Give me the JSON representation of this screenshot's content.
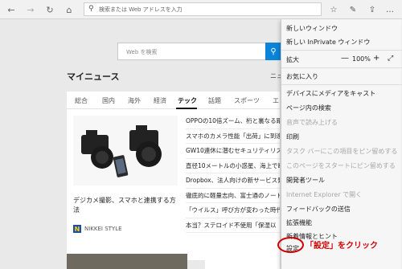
{
  "toolbar": {
    "address_placeholder": "検索または Web アドレスを入力"
  },
  "page": {
    "search_placeholder": "Web を検索",
    "section_title": "マイニュース",
    "section_extra": "ニュ",
    "tabs": [
      "総合",
      "国内",
      "海外",
      "経済",
      "テック",
      "話題",
      "スポーツ",
      "エ"
    ],
    "active_tab": "テック",
    "photo_caption": "デジカメ撮影、スマホと連携する方法",
    "source": "NIKKEI STYLE",
    "source_logo_letter": "N",
    "headlines": [
      "OPPOの10倍ズーム、桁と裏なる躍",
      "スマホのカメラ性能「出荷」に到達",
      "GW10連休に潜むセキュリティリスク",
      "直径10メートルの小惑星、海上で断",
      "Dropbox、法人向けの新サービス発",
      "徹底的に軽量志向、富士通のノート",
      "「ウイルス」呼び方が変わった時代",
      "本当？ステロイド不使用「保湿以"
    ]
  },
  "menu": {
    "items": [
      {
        "label": "新しいウィンドウ",
        "disabled": false
      },
      {
        "label": "新しい InPrivate ウィンドウ",
        "disabled": false
      },
      {
        "label": "拡大",
        "disabled": false
      },
      {
        "label": "お気に入り",
        "disabled": false
      },
      {
        "label": "デバイスにメディアをキャスト",
        "disabled": false
      },
      {
        "label": "ページ内の検索",
        "disabled": false
      },
      {
        "label": "音声で読み上げる",
        "disabled": true
      },
      {
        "label": "印刷",
        "disabled": false
      },
      {
        "label": "タスク バーにこの項目をピン留めする",
        "disabled": true
      },
      {
        "label": "このページをスタートにピン留めする",
        "disabled": true
      },
      {
        "label": "開発者ツール",
        "disabled": false
      },
      {
        "label": "Internet Explorer で開く",
        "disabled": true
      },
      {
        "label": "フィードバックの送信",
        "disabled": false
      },
      {
        "label": "拡張機能",
        "disabled": false
      },
      {
        "label": "新着情報とヒント",
        "disabled": false
      },
      {
        "label": "設定",
        "disabled": false
      }
    ],
    "zoom_value": "100%",
    "zoom_minus": "—",
    "zoom_plus": "+"
  },
  "annotation": {
    "text": "「設定」をクリック",
    "color": "#d40000"
  },
  "icons": {
    "back": "back-arrow-icon",
    "forward": "forward-arrow-icon",
    "refresh": "refresh-icon",
    "home": "home-icon",
    "search": "search-icon",
    "favorite": "star-icon",
    "pen": "pen-icon",
    "share": "share-icon",
    "more": "more-icon"
  }
}
